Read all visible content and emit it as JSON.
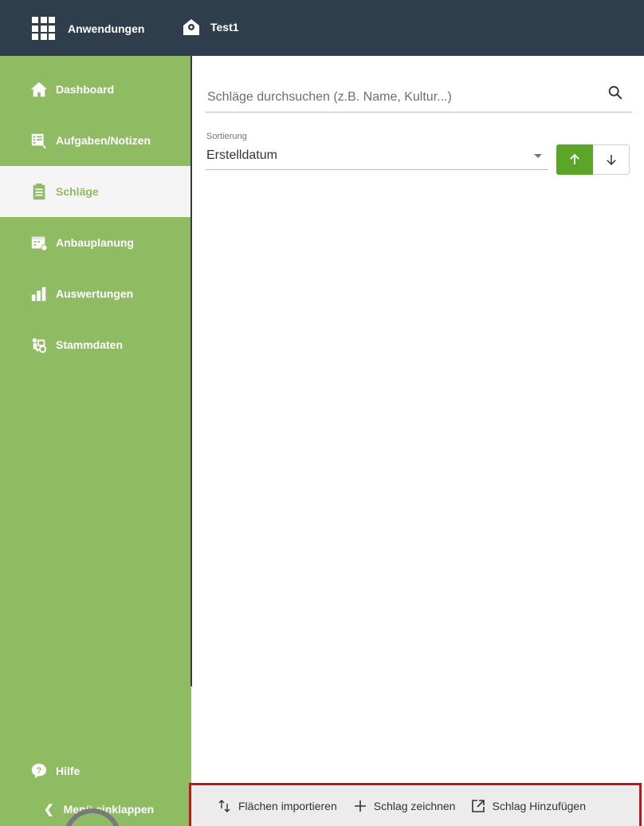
{
  "topbar": {
    "apps_label": "Anwendungen",
    "farm_label": "Test1"
  },
  "sidebar": {
    "items": [
      {
        "label": "Dashboard",
        "icon": "home-icon"
      },
      {
        "label": "Aufgaben/Notizen",
        "icon": "tasks-icon"
      },
      {
        "label": "Schläge",
        "icon": "clipboard-icon",
        "active": true
      },
      {
        "label": "Anbauplanung",
        "icon": "calendar-icon"
      },
      {
        "label": "Auswertungen",
        "icon": "bar-chart-icon"
      },
      {
        "label": "Stammdaten",
        "icon": "tractor-icon"
      }
    ],
    "help_label": "Hilfe",
    "collapse_label": "Menü einklappen"
  },
  "search": {
    "placeholder": "Schläge durchsuchen (z.B. Name, Kultur...)"
  },
  "sort": {
    "label": "Sortierung",
    "value": "Erstelldatum"
  },
  "actions": {
    "import_label": "Flächen importieren",
    "draw_label": "Schlag zeichnen",
    "add_label": "Schlag Hinzufügen"
  },
  "colors": {
    "topbar": "#2f3e4c",
    "sidebar": "#8fbb62",
    "accent": "#5ba52a",
    "highlight": "#c0161a"
  }
}
